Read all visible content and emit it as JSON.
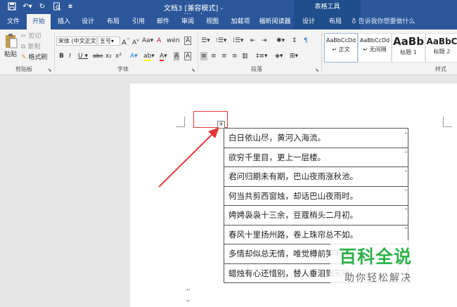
{
  "titlebar": {
    "doc_title": "文档3 [兼容模式] - Word",
    "ctx_tab_title": "表格工具",
    "qat": [
      "save-icon",
      "undo-icon",
      "redo-icon",
      "print-preview-icon",
      "customize-icon"
    ]
  },
  "menu": {
    "tabs": [
      "文件",
      "开始",
      "插入",
      "设计",
      "布局",
      "引用",
      "邮件",
      "审阅",
      "视图",
      "加载项",
      "福昕阅读器",
      "设计",
      "布局"
    ],
    "active": "开始",
    "tellme": "告诉我你想要做什么"
  },
  "ribbon": {
    "clipboard": {
      "paste": "粘贴",
      "cut": "剪切",
      "copy": "复制",
      "format_painter": "格式刷",
      "label": "剪贴板"
    },
    "font": {
      "name": "宋体 (中文正文",
      "size": "五号",
      "label": "字体",
      "buttons": [
        "A",
        "A",
        "Aa",
        "A",
        "文",
        "A",
        "B",
        "I",
        "U",
        "abc",
        "x₂",
        "x²",
        "A",
        "A",
        "A",
        "A"
      ]
    },
    "paragraph": {
      "label": "段落"
    },
    "styles": {
      "label": "样式",
      "items": [
        {
          "sample": "AaBbCcDd",
          "name": "↵ 正文"
        },
        {
          "sample": "AaBbCcDd",
          "name": "↵ 无间隔"
        },
        {
          "sample": "AaBb",
          "name": "标题 1"
        },
        {
          "sample": "AaBbC",
          "name": "标题 2"
        }
      ]
    }
  },
  "table": {
    "rows": [
      "白日依山尽，黄河入海流。",
      "欲穷千里目，更上一层楼。",
      "君问归期未有期，巴山夜雨涨秋池。",
      "何当共剪西窗烛，却话巴山夜雨时。",
      "娉娉袅袅十三余，豆蔻梢头二月初。",
      "春风十里扬州路，卷上珠帘总不如。",
      "多情却似总无情，唯觉樽前笑不成。",
      "蜡烛有心还惜别，替人垂泪到天明。"
    ]
  },
  "watermark": {
    "main": "百科全说",
    "sub": "助你轻松解决"
  },
  "colors": {
    "ribbon_blue": "#2b579a",
    "annotation_red": "#e23b3b",
    "watermark_green": "#2fb24c"
  }
}
